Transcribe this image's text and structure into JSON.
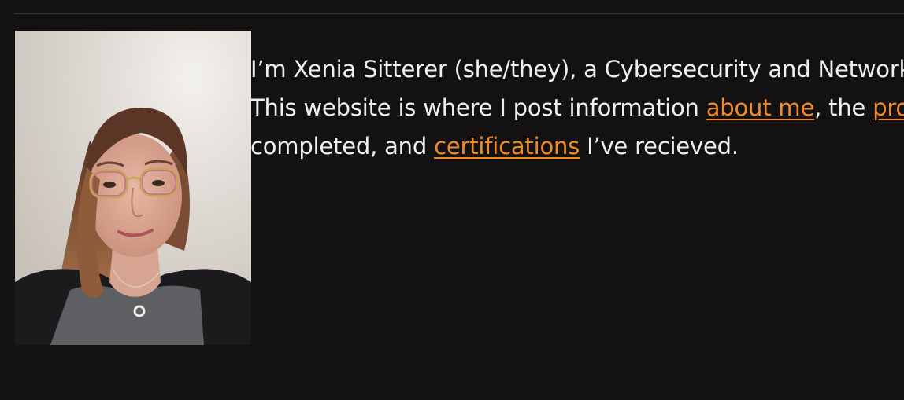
{
  "intro": {
    "line1": "I’m Xenia Sitterer (she/they), a Cybersecurity and Network",
    "line2_before": "This website is where I post information ",
    "link_about": "about me",
    "line2_mid": ", the ",
    "link_projects": "pro",
    "line3_before": "completed, and ",
    "link_certs": "certifications",
    "line3_after": " I’ve recieved."
  },
  "colors": {
    "background": "#141112",
    "text": "#f1eeee",
    "link": "#f08a24",
    "divider": "#3a3637"
  }
}
